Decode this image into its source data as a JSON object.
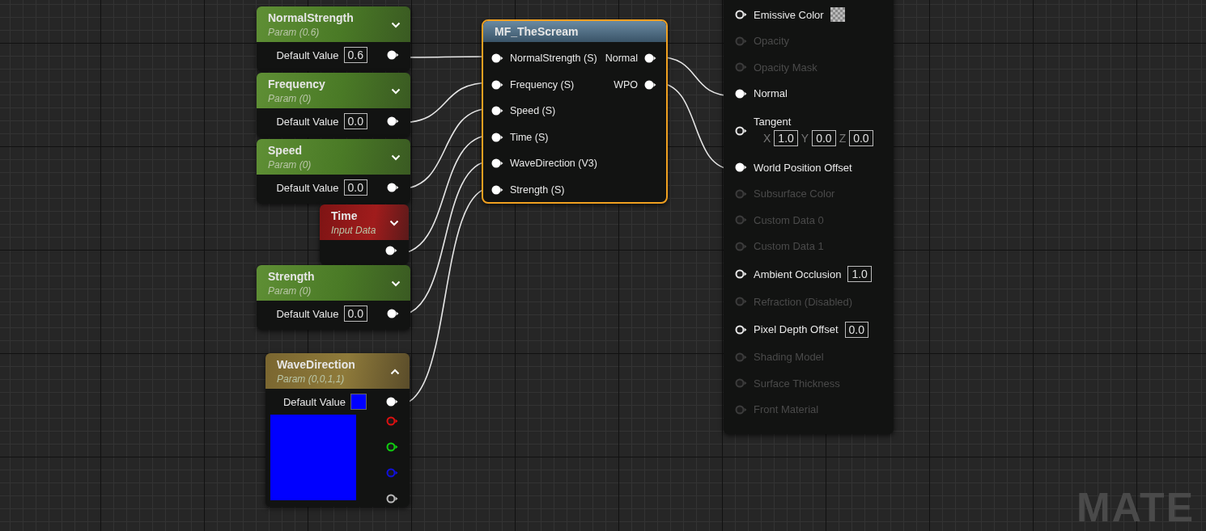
{
  "param_nodes": [
    {
      "kind": "scalar",
      "title": "NormalStrength",
      "subtitle": "Param (0.6)",
      "expanded": false,
      "default_label": "Default Value",
      "default_value": "0.6"
    },
    {
      "kind": "scalar",
      "title": "Frequency",
      "subtitle": "Param (0)",
      "expanded": false,
      "default_label": "Default Value",
      "default_value": "0.0"
    },
    {
      "kind": "scalar",
      "title": "Speed",
      "subtitle": "Param (0)",
      "expanded": false,
      "default_label": "Default Value",
      "default_value": "0.0"
    },
    {
      "kind": "input",
      "title": "Time",
      "subtitle": "Input Data",
      "expanded": false
    },
    {
      "kind": "scalar",
      "title": "Strength",
      "subtitle": "Param (0)",
      "expanded": false,
      "default_label": "Default Value",
      "default_value": "0.0"
    },
    {
      "kind": "vector",
      "title": "WaveDirection",
      "subtitle": "Param (0,0,1,1)",
      "expanded": true,
      "default_label": "Default Value",
      "color": "#0000ff"
    }
  ],
  "function_node": {
    "title": "MF_TheScream",
    "selected": true,
    "inputs": [
      "NormalStrength (S)",
      "Frequency (S)",
      "Speed (S)",
      "Time (S)",
      "WaveDirection (V3)",
      "Strength (S)"
    ],
    "outputs": [
      "Normal",
      "WPO"
    ]
  },
  "material_node": {
    "pins": [
      {
        "kind": "swatch",
        "label": "Emissive Color",
        "enabled": true,
        "connected": false
      },
      {
        "kind": "plain",
        "label": "Opacity",
        "enabled": false,
        "connected": false
      },
      {
        "kind": "plain",
        "label": "Opacity Mask",
        "enabled": false,
        "connected": false
      },
      {
        "kind": "plain",
        "label": "Normal",
        "enabled": true,
        "connected": true
      },
      {
        "kind": "vector",
        "label": "Tangent",
        "enabled": true,
        "connected": false,
        "fields": [
          {
            "axis": "X",
            "value": "1.0"
          },
          {
            "axis": "Y",
            "value": "0.0"
          },
          {
            "axis": "Z",
            "value": "0.0"
          }
        ]
      },
      {
        "kind": "plain",
        "label": "World Position Offset",
        "enabled": true,
        "connected": true
      },
      {
        "kind": "plain",
        "label": "Subsurface Color",
        "enabled": false,
        "connected": false
      },
      {
        "kind": "plain",
        "label": "Custom Data 0",
        "enabled": false,
        "connected": false
      },
      {
        "kind": "plain",
        "label": "Custom Data 1",
        "enabled": false,
        "connected": false
      },
      {
        "kind": "scalar",
        "label": "Ambient Occlusion",
        "enabled": true,
        "connected": false,
        "value": "1.0"
      },
      {
        "kind": "plain",
        "label": "Refraction (Disabled)",
        "enabled": false,
        "connected": false
      },
      {
        "kind": "scalar",
        "label": "Pixel Depth Offset",
        "enabled": true,
        "connected": false,
        "value": "0.0"
      },
      {
        "kind": "plain",
        "label": "Shading Model",
        "enabled": false,
        "connected": false
      },
      {
        "kind": "plain",
        "label": "Surface Thickness",
        "enabled": false,
        "connected": false
      },
      {
        "kind": "plain",
        "label": "Front Material",
        "enabled": false,
        "connected": false
      }
    ]
  },
  "graph_label": "MATE"
}
